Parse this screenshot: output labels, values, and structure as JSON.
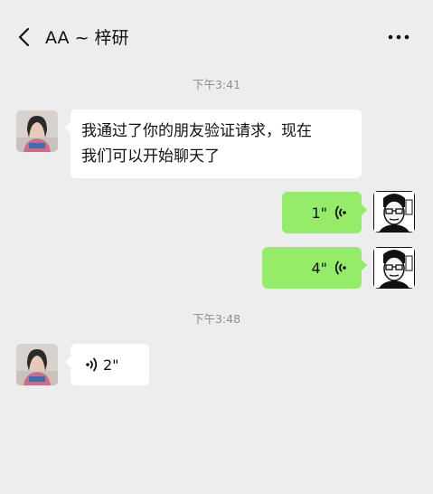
{
  "header": {
    "title": "AA ~ 梓研"
  },
  "messages": [
    {
      "type": "time",
      "text": "下午3:41"
    },
    {
      "type": "text",
      "side": "left",
      "text_line1": "我通过了你的朋友验证请求，现在",
      "text_line2": "我们可以开始聊天了"
    },
    {
      "type": "voice",
      "side": "right",
      "duration": "1\""
    },
    {
      "type": "voice",
      "side": "right",
      "duration": "4\""
    },
    {
      "type": "time",
      "text": "下午3:48"
    },
    {
      "type": "voice",
      "side": "left",
      "duration": "2\""
    }
  ],
  "icons": {
    "back": "chevron-left-icon",
    "more": "ellipsis-icon",
    "voice_wave": "voice-wave-icon"
  },
  "colors": {
    "background": "#ededed",
    "bubble_self": "#95ec69",
    "bubble_other": "#ffffff",
    "timestamp": "#8e8e8e"
  }
}
